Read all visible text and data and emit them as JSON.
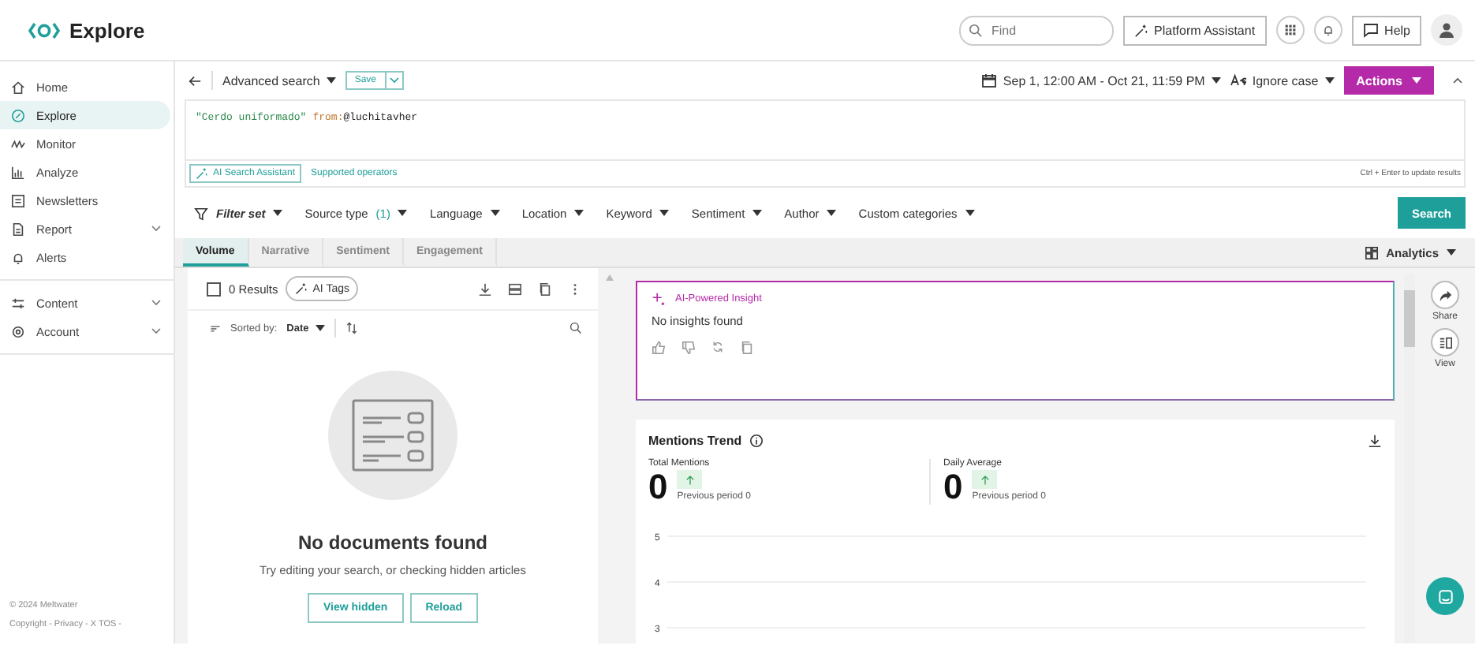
{
  "header": {
    "title": "Explore",
    "search": {
      "placeholder": "Find"
    },
    "assistant_button": "Platform Assistant",
    "help_button": "Help"
  },
  "sidebar": {
    "sections": [
      {
        "items": [
          {
            "label": "Home",
            "selected": false,
            "expandable": false
          },
          {
            "label": "Explore",
            "selected": true,
            "expandable": false
          },
          {
            "label": "Monitor",
            "selected": false,
            "expandable": false
          },
          {
            "label": "Analyze",
            "selected": false,
            "expandable": false
          },
          {
            "label": "Newsletters",
            "selected": false,
            "expandable": false
          },
          {
            "label": "Report",
            "selected": false,
            "expandable": true
          },
          {
            "label": "Alerts",
            "selected": false,
            "expandable": false
          }
        ]
      },
      {
        "items": [
          {
            "label": "Content",
            "selected": false,
            "expandable": true
          },
          {
            "label": "Account",
            "selected": false,
            "expandable": true
          }
        ]
      }
    ],
    "footer": [
      "©  2024 Meltwater",
      "Copyright - Privacy - X TOS -"
    ]
  },
  "toolbar": {
    "search_name": "Advanced search",
    "save_button": "Save",
    "date_range": "Sep 1, 12:00 AM - Oct 21, 11:59 PM",
    "case_option": "Ignore case",
    "actions_button": "Actions"
  },
  "query": {
    "tokens": [
      {
        "kind": "phrase",
        "text": "\"Cerdo uniformado\""
      },
      {
        "kind": "operator",
        "text": "from:"
      },
      {
        "kind": "value",
        "text": "@luchitavher"
      }
    ]
  },
  "assist": {
    "ai_button": "AI Search Assistant",
    "operators_link": "Supported operators",
    "hint": "Ctrl + Enter to update results"
  },
  "filters": [
    {
      "label": "Filter set",
      "kind": "set"
    },
    {
      "label": "Source type",
      "kind": "menu",
      "count": "(1)"
    },
    {
      "label": "Language",
      "kind": "menu"
    },
    {
      "label": "Location",
      "kind": "menu"
    },
    {
      "label": "Keyword",
      "kind": "menu"
    },
    {
      "label": "Sentiment",
      "kind": "menu"
    },
    {
      "label": "Author",
      "kind": "menu"
    },
    {
      "label": "Custom categories",
      "kind": "menu"
    }
  ],
  "search_button": "Search",
  "tabs": [
    {
      "label": "Volume",
      "selected": true
    },
    {
      "label": "Narrative",
      "selected": false
    },
    {
      "label": "Sentiment",
      "selected": false
    },
    {
      "label": "Engagement",
      "selected": false
    }
  ],
  "analytics_menu": "Analytics",
  "results": {
    "count": "0 Results",
    "checked": false,
    "ai_tags": "AI Tags",
    "sort_label": "Sorted by:",
    "sort_value": "Date",
    "empty_title": "No documents found",
    "empty_text": "Try editing your search, or checking hidden articles",
    "buttons": [
      "View hidden",
      "Reload"
    ]
  },
  "insight": {
    "title": "AI-Powered Insight",
    "text": "No insights found"
  },
  "trend": {
    "title": "Mentions Trend",
    "stats": [
      {
        "label": "Total Mentions",
        "value": "0",
        "previous": "Previous period 0"
      },
      {
        "label": "Daily Average",
        "value": "0",
        "previous": "Previous period 0"
      }
    ],
    "y_axis_labels": [
      "5",
      "4",
      "3"
    ]
  },
  "side_actions": [
    {
      "label": "Share"
    },
    {
      "label": "View"
    }
  ]
}
